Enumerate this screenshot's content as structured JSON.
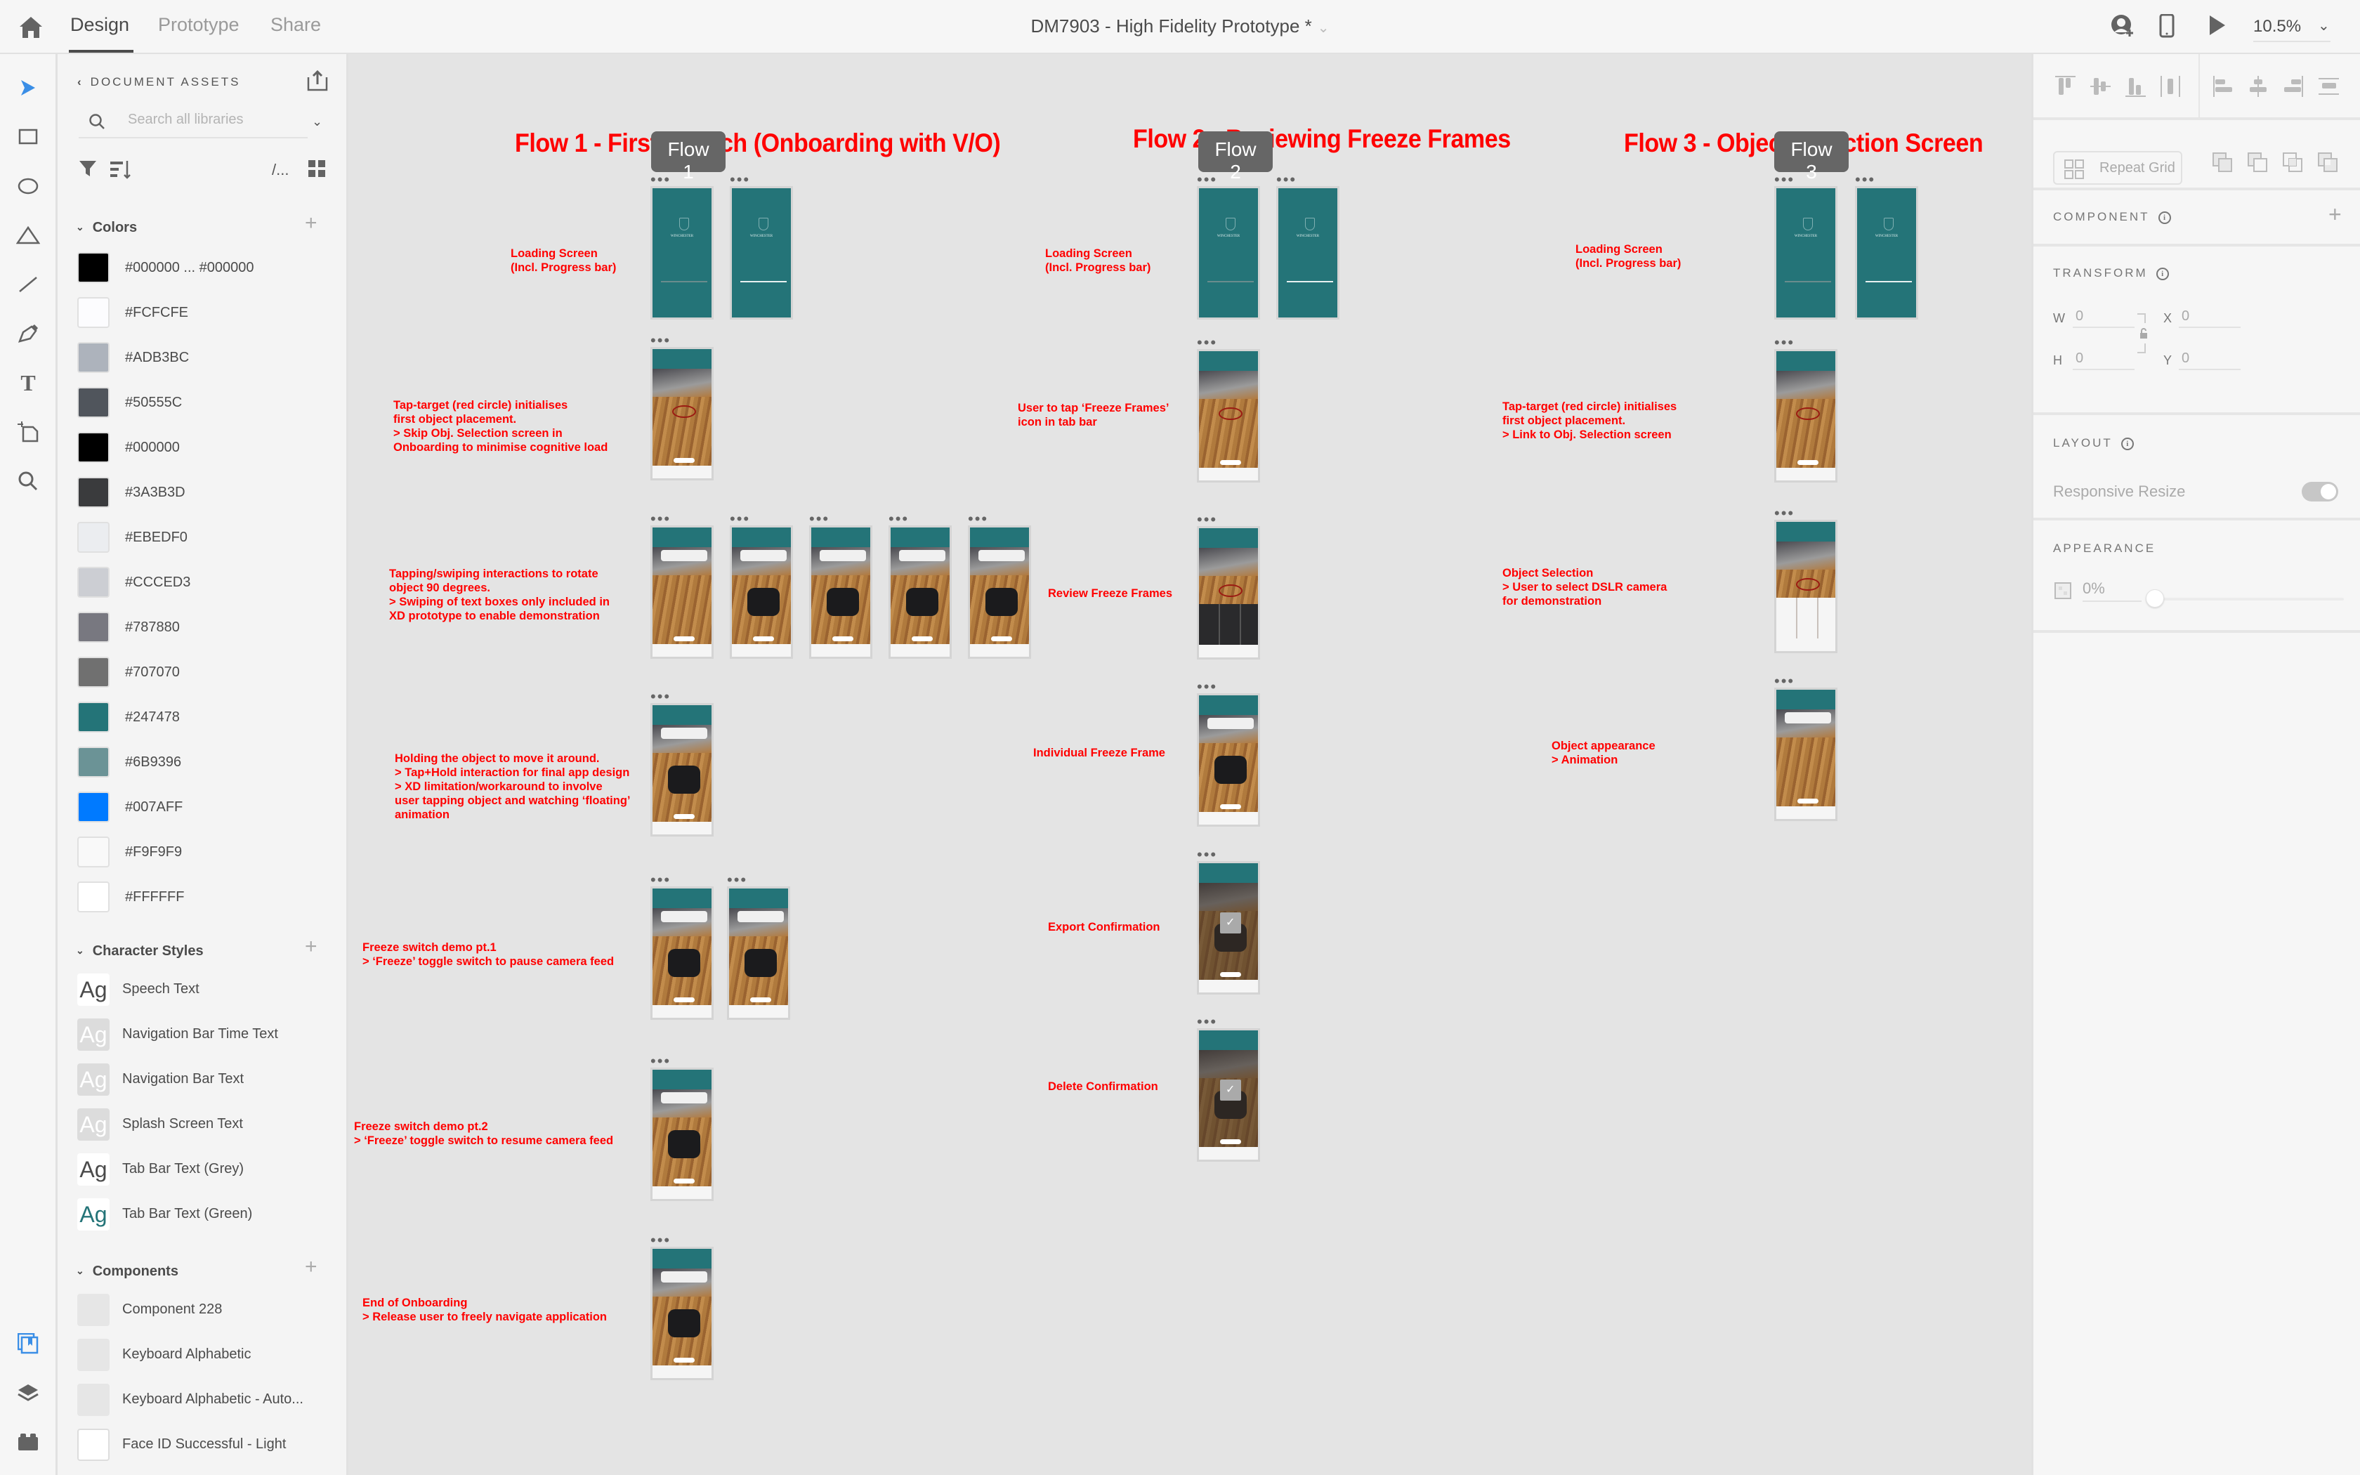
{
  "app": {
    "tabs": [
      {
        "label": "Design",
        "active": true
      },
      {
        "label": "Prototype",
        "active": false
      },
      {
        "label": "Share",
        "active": false
      }
    ],
    "document_title": "DM7903 - High Fidelity Prototype *",
    "zoom_level": "10.5%"
  },
  "tool_rail": {
    "tools": [
      "select-tool",
      "rectangle-tool",
      "ellipse-tool",
      "polygon-tool",
      "line-tool",
      "pen-tool",
      "text-tool",
      "artboard-tool",
      "zoom-tool"
    ],
    "bottom": [
      "assets-panel",
      "layers-panel",
      "plugins-panel"
    ]
  },
  "assets": {
    "title": "DOCUMENT ASSETS",
    "search_placeholder": "Search all libraries",
    "path_toggle": "/...",
    "colors_header": "Colors",
    "colors": [
      {
        "label": "#000000 ... #000000",
        "hex": "#000000"
      },
      {
        "label": "#FCFCFE",
        "hex": "#FCFCFE"
      },
      {
        "label": "#ADB3BC",
        "hex": "#ADB3BC"
      },
      {
        "label": "#50555C",
        "hex": "#50555C"
      },
      {
        "label": "#000000",
        "hex": "#000000"
      },
      {
        "label": "#3A3B3D",
        "hex": "#3A3B3D"
      },
      {
        "label": "#EBEDF0",
        "hex": "#EBEDF0"
      },
      {
        "label": "#CCCED3",
        "hex": "#CCCED3"
      },
      {
        "label": "#787880",
        "hex": "#787880"
      },
      {
        "label": "#707070",
        "hex": "#707070"
      },
      {
        "label": "#247478",
        "hex": "#247478"
      },
      {
        "label": "#6B9396",
        "hex": "#6B9396"
      },
      {
        "label": "#007AFF",
        "hex": "#007AFF"
      },
      {
        "label": "#F9F9F9",
        "hex": "#F9F9F9"
      },
      {
        "label": "#FFFFFF",
        "hex": "#FFFFFF"
      }
    ],
    "char_styles_header": "Character Styles",
    "char_styles": [
      {
        "label": "Speech Text",
        "preview": "Ag",
        "style": "plain"
      },
      {
        "label": "Navigation Bar Time Text",
        "preview": "Ag",
        "style": "grey"
      },
      {
        "label": "Navigation Bar Text",
        "preview": "Ag",
        "style": "grey"
      },
      {
        "label": "Splash Screen Text",
        "preview": "Ag",
        "style": "grey"
      },
      {
        "label": "Tab Bar Text (Grey)",
        "preview": "Ag",
        "style": "plain"
      },
      {
        "label": "Tab Bar Text (Green)",
        "preview": "Ag",
        "style": "green"
      }
    ],
    "components_header": "Components",
    "components": [
      {
        "label": "Component 228"
      },
      {
        "label": "Keyboard Alphabetic"
      },
      {
        "label": "Keyboard Alphabetic - Auto..."
      },
      {
        "label": "Face ID Successful - Light"
      }
    ]
  },
  "canvas": {
    "flows": [
      {
        "title": "Flow 1 - First Launch (Onboarding with V/O)",
        "badge": "Flow 1"
      },
      {
        "title": "Flow 2 - Reviewing Freeze Frames",
        "badge": "Flow 2"
      },
      {
        "title": "Flow 3 - Object Selection Screen",
        "badge": "Flow 3"
      }
    ],
    "notes": {
      "f1_loading": "Loading Screen\n(Incl. Progress bar)",
      "f1_tap": "Tap-target (red circle) initialises\nfirst object placement.\n> Skip Obj. Selection screen in\nOnboarding to minimise cognitive load",
      "f1_rotate": "Tapping/swiping interactions to rotate\nobject 90 degrees.\n> Swiping of text boxes only included in\nXD prototype to enable demonstration",
      "f1_hold": "Holding the object to move it around.\n> Tap+Hold interaction for final app design\n> XD limitation/workaround to involve\nuser tapping object and watching ‘floating’\nanimation",
      "f1_freeze1": "Freeze switch demo pt.1\n> ‘Freeze’ toggle switch to pause camera feed",
      "f1_freeze2": "Freeze switch demo pt.2\n> ‘Freeze’ toggle switch to resume camera feed",
      "f1_end": "End of Onboarding\n> Release user to freely navigate application",
      "f2_loading": "Loading Screen\n(Incl. Progress bar)",
      "f2_tap": "User to tap ‘Freeze Frames’\nicon in tab bar",
      "f2_review": "Review Freeze Frames",
      "f2_individual": "Individual Freeze Frame",
      "f2_export": "Export Confirmation",
      "f2_delete": "Delete Confirmation",
      "f3_loading": "Loading Screen\n(Incl. Progress bar)",
      "f3_tap": "Tap-target (red circle) initialises\nfirst object placement.\n> Link to Obj. Selection screen",
      "f3_select": "Object Selection\n> User to select DSLR camera\nfor demonstration",
      "f3_appear": "Object appearance\n> Animation"
    },
    "artboard_menu": "•••"
  },
  "properties": {
    "repeat_grid": "Repeat Grid",
    "component_label": "COMPONENT",
    "transform_label": "TRANSFORM",
    "w_label": "W",
    "w_value": "0",
    "x_label": "X",
    "x_value": "0",
    "h_label": "H",
    "h_value": "0",
    "y_label": "Y",
    "y_value": "0",
    "layout_label": "LAYOUT",
    "responsive_resize": "Responsive Resize",
    "responsive_resize_on": true,
    "appearance_label": "APPEARANCE",
    "opacity_value": "0%",
    "opacity_fraction": 0
  }
}
